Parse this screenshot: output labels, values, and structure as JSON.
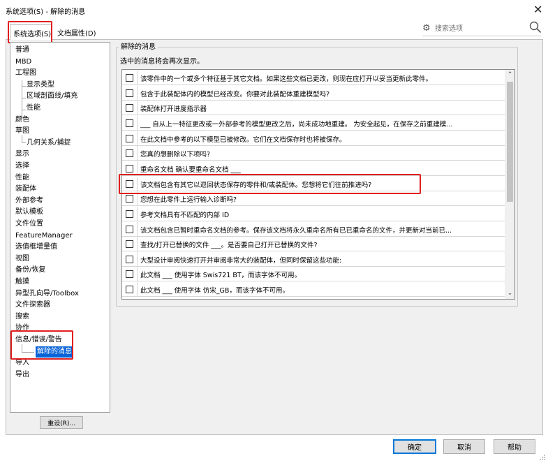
{
  "window": {
    "title": "系统选项(S) - 解除的消息",
    "close_icon": "close-icon"
  },
  "tabs": [
    {
      "label": "系统选项(S)",
      "active": true
    },
    {
      "label": "文档属性(D)",
      "active": false
    }
  ],
  "search": {
    "placeholder": "搜索选项"
  },
  "tree": [
    {
      "label": "普通",
      "child": false
    },
    {
      "label": "MBD",
      "child": false
    },
    {
      "label": "工程图",
      "child": false
    },
    {
      "label": "显示类型",
      "child": true
    },
    {
      "label": "区域剖面线/填充",
      "child": true
    },
    {
      "label": "性能",
      "child": true
    },
    {
      "label": "颜色",
      "child": false
    },
    {
      "label": "草图",
      "child": false
    },
    {
      "label": "几何关系/捕捉",
      "child": true
    },
    {
      "label": "显示",
      "child": false
    },
    {
      "label": "选择",
      "child": false
    },
    {
      "label": "性能",
      "child": false
    },
    {
      "label": "装配体",
      "child": false
    },
    {
      "label": "外部参考",
      "child": false
    },
    {
      "label": "默认模板",
      "child": false
    },
    {
      "label": "文件位置",
      "child": false
    },
    {
      "label": "FeatureManager",
      "child": false
    },
    {
      "label": "选值框增量值",
      "child": false
    },
    {
      "label": "视图",
      "child": false
    },
    {
      "label": "备份/恢复",
      "child": false
    },
    {
      "label": "触摸",
      "child": false
    },
    {
      "label": "异型孔向导/Toolbox",
      "child": false
    },
    {
      "label": "文件探索器",
      "child": false
    },
    {
      "label": "搜索",
      "child": false
    },
    {
      "label": "协作",
      "child": false
    },
    {
      "label": "信息/错误/警告",
      "child": false
    },
    {
      "label": "解除的消息",
      "child": true,
      "selected": true
    },
    {
      "label": "导入",
      "child": false
    },
    {
      "label": "导出",
      "child": false
    }
  ],
  "reset_label": "重设(R)...",
  "group": {
    "title": "解除的消息",
    "description": "选中的消息将会再次显示。"
  },
  "messages": [
    {
      "text": "该零件中的一个或多个特征基于其它文档。如果这些文档已更改，则现在应打开以妥当更新此零件。",
      "checked": false
    },
    {
      "text": "包含于此装配体内的模型已经改变。你要对此装配体重建模型吗?",
      "checked": false
    },
    {
      "text": "装配体打开进度指示器",
      "checked": false
    },
    {
      "text": "___ 自从上一特征更改或一外部参考的模型更改之后，尚未成功地重建。 为安全起见，在保存之前重建模...",
      "checked": false
    },
    {
      "text": "在此文档中参考的以下模型已被修改。它们在文档保存时也将被保存。",
      "checked": false
    },
    {
      "text": "您真的想删除以下项吗?",
      "checked": false
    },
    {
      "text": "重命名文档 确认要重命名文档 ___",
      "checked": false
    },
    {
      "text": "该文档包含有其它以退回状态保存的零件和/或装配体。您想将它们往前推进吗?",
      "checked": false
    },
    {
      "text": "您想在此零件上运行输入诊断吗?",
      "checked": false
    },
    {
      "text": "参考文档具有不匹配的内部 ID",
      "checked": false
    },
    {
      "text": "该文档包含已暂时重命名文档的参考。保存该文档将永久重命名所有已已重命名的文件，并更新对当前已...",
      "checked": false
    },
    {
      "text": "查找/打开已替换的文件 ___。是否要自己打开已替换的文件?",
      "checked": false
    },
    {
      "text": "大型设计审阅快速打开并审阅非常大的装配体，但同时保留这些功能:",
      "checked": false
    },
    {
      "text": "此文档 ___ 使用字体 Swis721 BT，而该字体不可用。",
      "checked": false
    },
    {
      "text": "此文档 ___ 使用字体 仿宋_GB，而该字体不可用。",
      "checked": false
    }
  ],
  "footer": {
    "ok": "确定",
    "cancel": "取消",
    "help": "帮助"
  },
  "colors": {
    "highlight": "#e02020",
    "selection": "#0a64d8",
    "dialog_bg": "#f0f0f0"
  }
}
